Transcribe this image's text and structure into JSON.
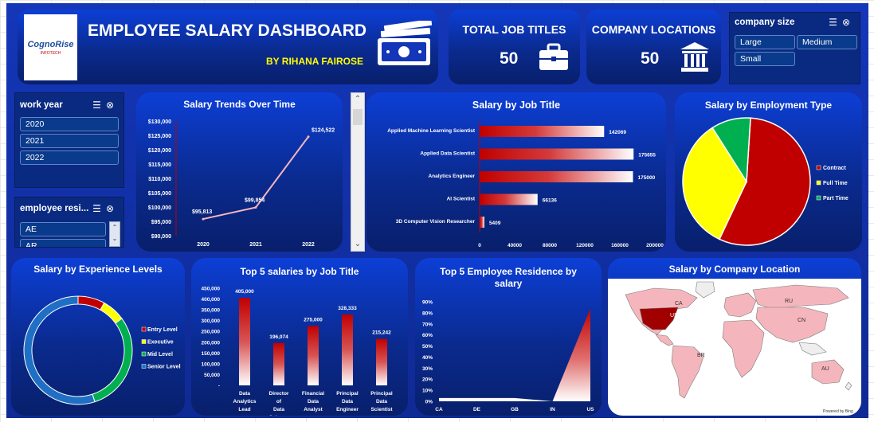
{
  "header": {
    "logo_name": "CognoRise",
    "logo_sub": "INFOTECH",
    "title": "EMPLOYEE SALARY DASHBOARD",
    "byline": "BY RIHANA FAIROSE"
  },
  "kpis": [
    {
      "label": "TOTAL JOB TITLES",
      "value": "50",
      "icon": "briefcase-icon"
    },
    {
      "label": "COMPANY LOCATIONS",
      "value": "50",
      "icon": "building-icon"
    }
  ],
  "slicers": {
    "company_size": {
      "title": "company size",
      "items": [
        "Large",
        "Medium",
        "Small"
      ]
    },
    "work_year": {
      "title": "work year",
      "items": [
        "2020",
        "2021",
        "2022"
      ]
    },
    "employee_residence": {
      "title": "employee resi...",
      "items": [
        "AE",
        "AR"
      ]
    }
  },
  "chart_data": [
    {
      "type": "line",
      "title": "Salary Trends Over Time",
      "categories": [
        "2020",
        "2021",
        "2022"
      ],
      "values": [
        95813,
        99854,
        124522
      ],
      "data_labels": [
        "$95,813",
        "$99,854",
        "$124,522"
      ],
      "y_ticks": [
        "$130,000",
        "$125,000",
        "$120,000",
        "$115,000",
        "$110,000",
        "$105,000",
        "$100,000",
        "$95,000",
        "$90,000"
      ],
      "ylim": [
        90000,
        130000
      ]
    },
    {
      "type": "bar",
      "title": "Salary  by Job Title",
      "orientation": "horizontal",
      "categories": [
        "Applied Machine Learning Scientist",
        "Applied Data Scientist",
        "Analytics Engineer",
        "AI Scientist",
        "3D Computer Vision Researcher"
      ],
      "values": [
        142069,
        175655,
        175000,
        66136,
        5409
      ],
      "data_labels": [
        "142069",
        "175655",
        "175000",
        "66136",
        "5409"
      ],
      "x_ticks": [
        "0",
        "40000",
        "80000",
        "120000",
        "160000",
        "200000"
      ],
      "xlim": [
        0,
        200000
      ]
    },
    {
      "type": "pie",
      "title": "Salary by Employment Type",
      "categories": [
        "Contract",
        "Full Time",
        "Part Time"
      ],
      "values": [
        56,
        34,
        10
      ],
      "colors": [
        "#c00000",
        "#ffff00",
        "#00b050"
      ]
    },
    {
      "type": "pie",
      "subtype": "doughnut",
      "title": "Salary by Experience Levels",
      "categories": [
        "Entry Level",
        "Executive",
        "Mid Level",
        "Senior Level"
      ],
      "values": [
        8,
        7,
        30,
        55
      ],
      "colors": [
        "#c00000",
        "#ffff00",
        "#00b050",
        "#1f6fc5"
      ]
    },
    {
      "type": "bar",
      "title": "Top 5 salaries by Job Title",
      "categories": [
        "Data Analytics Lead",
        "Director of Data Science",
        "Financial Data Analyst",
        "Principal Data Engineer",
        "Principal Data Scientist"
      ],
      "values": [
        405000,
        196074,
        275000,
        328333,
        215242
      ],
      "data_labels": [
        "405,000",
        "196,074",
        "275,000",
        "328,333",
        "215,242"
      ],
      "y_ticks": [
        "450,000",
        "400,000",
        "350,000",
        "300,000",
        "250,000",
        "200,000",
        "150,000",
        "100,000",
        "50,000",
        "-"
      ],
      "ylim": [
        0,
        450000
      ]
    },
    {
      "type": "area",
      "title": "Top 5 Employee Residence by salary",
      "categories": [
        "CA",
        "DE",
        "GB",
        "IN",
        "US"
      ],
      "values": [
        3,
        3,
        3,
        0,
        84
      ],
      "y_ticks": [
        "90%",
        "80%",
        "70%",
        "60%",
        "50%",
        "40%",
        "30%",
        "20%",
        "10%",
        "0%"
      ],
      "ylim": [
        0,
        90
      ]
    }
  ],
  "map": {
    "title": "Salary by Company Location",
    "labels": [
      "CA",
      "US",
      "RU",
      "CN",
      "BR",
      "AU"
    ],
    "credit": "Powered by Bing"
  }
}
